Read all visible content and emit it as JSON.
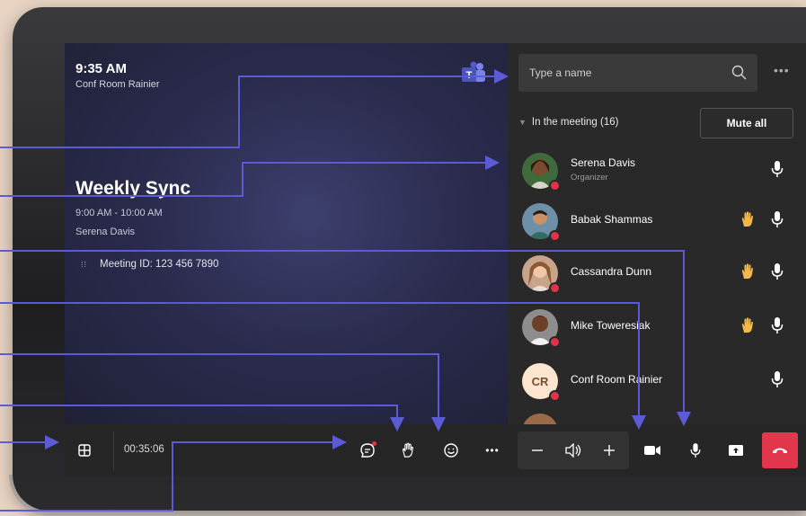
{
  "meeting": {
    "clock": "9:35 AM",
    "room": "Conf Room Rainier",
    "title": "Weekly Sync",
    "time_range": "9:00 AM - 10:00 AM",
    "organizer": "Serena Davis",
    "meeting_id": "Meeting ID: 123 456 7890"
  },
  "panel": {
    "search_placeholder": "Type a name",
    "section_label": "In the meeting (16)",
    "mute_all": "Mute all",
    "participants": [
      {
        "name": "Serena Davis",
        "role": "Organizer",
        "hand_raised": false
      },
      {
        "name": "Babak Shammas",
        "hand_raised": true
      },
      {
        "name": "Cassandra Dunn",
        "hand_raised": true
      },
      {
        "name": "Mike Toweresiak",
        "hand_raised": true
      },
      {
        "name": "Conf Room Rainier",
        "initials": "CR",
        "hand_raised": false
      }
    ]
  },
  "toolbar": {
    "call_timer": "00:35:06"
  },
  "icons": {
    "gallery": "gallery-grid-icon",
    "chat": "chat-icon",
    "raise_hand": "raise-hand-icon",
    "reactions": "smiley-icon",
    "more": "more-options-icon",
    "volume_down": "minus-icon",
    "speaker": "speaker-icon",
    "volume_up": "plus-icon",
    "camera": "camera-icon",
    "mic": "microphone-icon",
    "share": "share-screen-icon",
    "hangup": "hang-up-icon"
  },
  "colors": {
    "accent_annotation": "#5b5bd6",
    "hangup": "#e1364b",
    "presence_busy": "#e0334a",
    "hand": "#f2b84b"
  }
}
